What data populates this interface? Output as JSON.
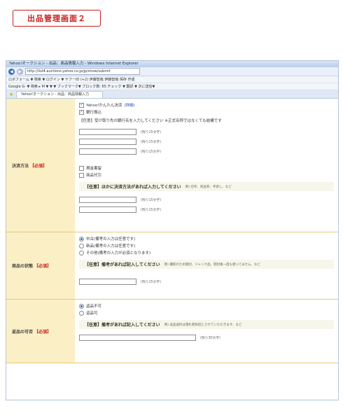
{
  "heading_badge": "出品管理画面２",
  "browser": {
    "title": "Yahoo!オークション - 出品：商品情報入力 - Windows Internet Explorer",
    "url": "http://list4.auctions.yahoo.co.jp/jp/show/submit",
    "toolbar1": "ロボフォーム ▼ 検索   ▼  ログイン ▼  ヤフーID (+2)   伊藤智哉   伊藤智哉   保存  作成",
    "toolbar2": "Google G-    ▼ 検索 ▸  M ▼  ▼  ▼  ブックマーク▼  ブロック数: 65  チェック ▼  翻訳 ▼  次に送信▼",
    "tab_label": "Yahoo!オークション - 出品：商品情報入力"
  },
  "payment": {
    "label": "決済方法",
    "required": "【必須】",
    "yahoo_easy": "Yahoo!かんたん決済",
    "yahoo_easy_link": "(詳細)",
    "bank": "銀行振込",
    "bank_notice": "【任意】受け取り先の銀行名を入力してください ※正式名称ではなくても結構です",
    "hint15": "(残り15文字)",
    "cash_registered": "現金書留",
    "cod": "商品代引",
    "other_optional": "【任意】ほかに決済方法があれば入力してください",
    "other_example": "例) 切手、商品券、手渡し、など"
  },
  "condition": {
    "label": "商品の状態",
    "required": "【必須】",
    "options": [
      "中古(備考の入力は任意です)",
      "新品(備考の入力は任意です)",
      "その他(備考の入力が必須となります)"
    ],
    "selected": 0,
    "remarks_title": "【任意】備考があれば記入してください",
    "remarks_example": "例) 撮影のため開封、ジャンク品、開封後一度も使ってません、など",
    "hint15": "(残り15文字)"
  },
  "returns": {
    "label": "返品の可否",
    "required": "【必須】",
    "options": [
      "返品不可",
      "返品可"
    ],
    "selected": 0,
    "remarks_title": "【任意】備考があれば記入してください",
    "remarks_example": "例) 返品送料は落札者負担とさせていただきます、など",
    "hint30": "(残り30文字)"
  },
  "colors": {
    "accent": "#c81e1e",
    "label_bg": "#fbefc6",
    "link": "#1b53b8"
  }
}
